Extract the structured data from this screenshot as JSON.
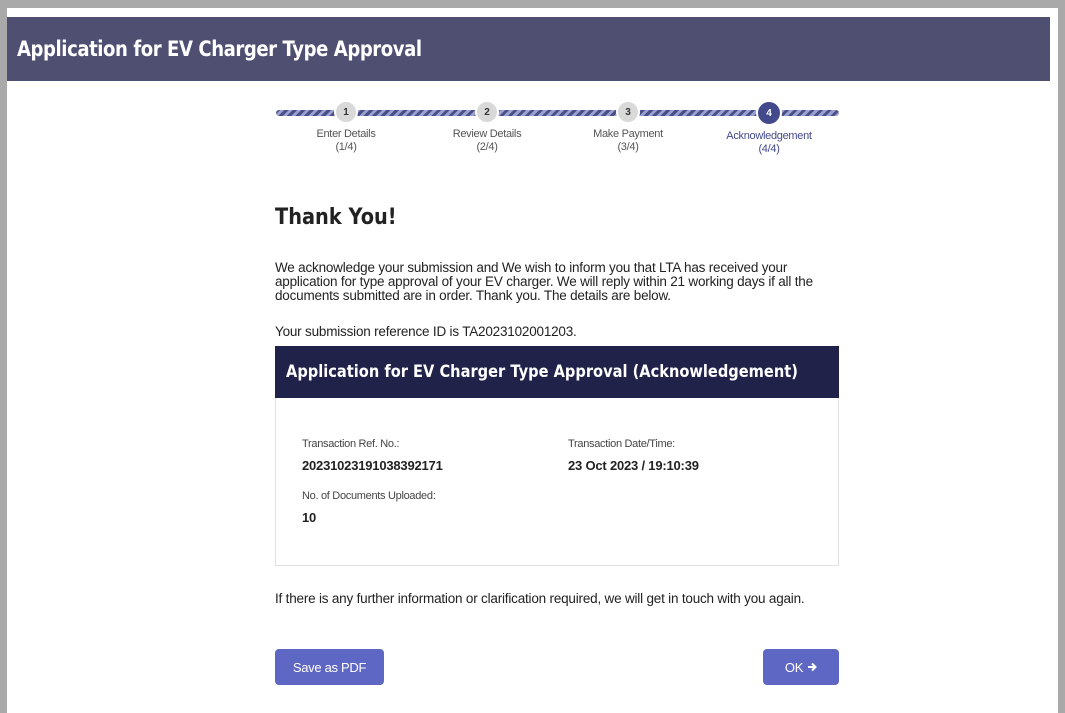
{
  "header": {
    "title": "Application for EV Charger Type Approval"
  },
  "stepper": {
    "steps": [
      {
        "number": "1",
        "label": "Enter Details",
        "progress": "(1/4)"
      },
      {
        "number": "2",
        "label": "Review Details",
        "progress": "(2/4)"
      },
      {
        "number": "3",
        "label": "Make Payment",
        "progress": "(3/4)"
      },
      {
        "number": "4",
        "label": "Acknowledgement",
        "progress": "(4/4)"
      }
    ],
    "active_step": 4
  },
  "main": {
    "thank_you": "Thank You!",
    "message": "We acknowledge your submission and We wish to inform you that LTA has received your application for type approval of your EV charger. We will reply within 21 working days if all the documents submitted are in order. Thank you. The details are below.",
    "reference_line": "Your submission reference ID is TA2023102001203.",
    "footer_note": "If there is any further information or clarification required, we will get in touch with you again."
  },
  "card": {
    "title": "Application for EV Charger Type Approval (Acknowledgement)",
    "chevron_icon": "chevron-down-icon",
    "fields": {
      "transaction_ref_label": "Transaction Ref. No.:",
      "transaction_ref_value": "20231023191038392171",
      "transaction_date_label": "Transaction Date/Time:",
      "transaction_date_value": "23 Oct 2023 / 19:10:39",
      "documents_label": "No. of Documents Uploaded:",
      "documents_value": "10"
    }
  },
  "buttons": {
    "save_pdf": "Save as PDF",
    "ok": "OK",
    "ok_icon": "arrow-right-icon"
  },
  "colors": {
    "header_bg": "#4f4f72",
    "card_header_bg": "#20224a",
    "accent": "#5f67c4",
    "active_step": "#434a8c"
  }
}
